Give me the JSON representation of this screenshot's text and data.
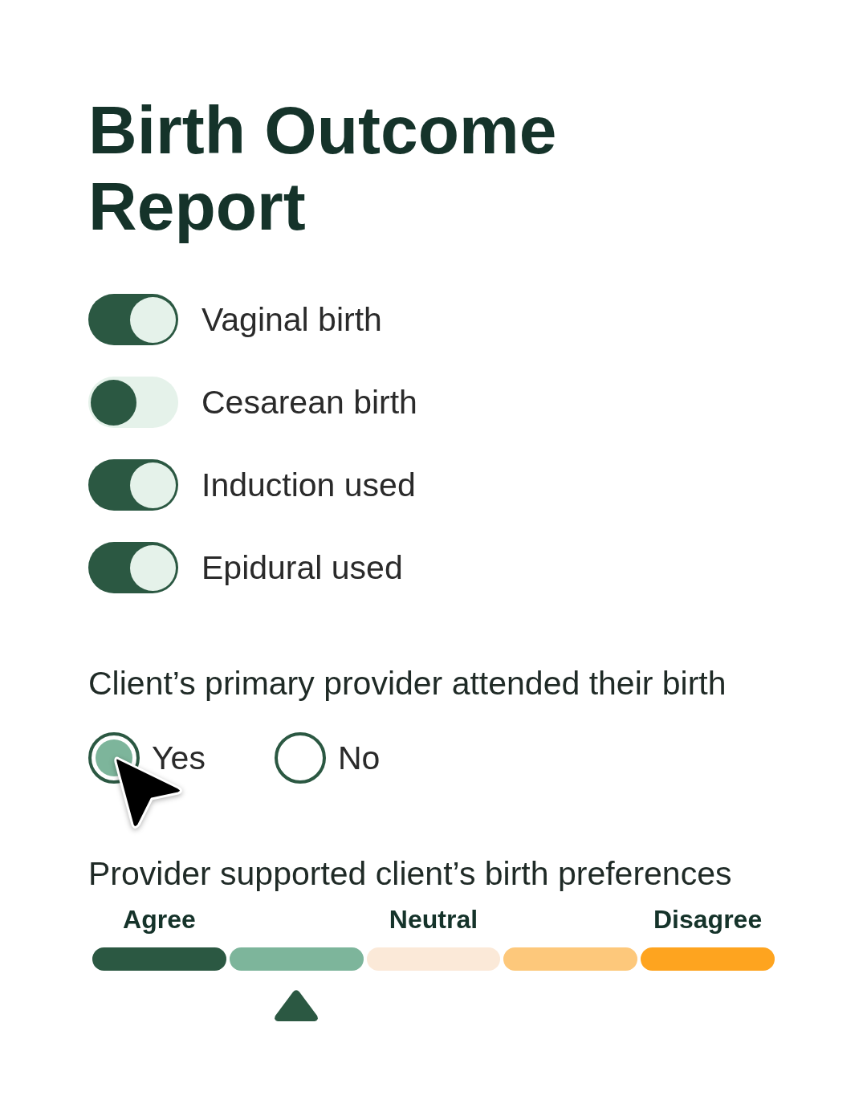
{
  "title": "Birth Outcome Report",
  "toggles": [
    {
      "label": "Vaginal birth",
      "on": true
    },
    {
      "label": "Cesarean birth",
      "on": false
    },
    {
      "label": "Induction used",
      "on": true
    },
    {
      "label": "Epidural used",
      "on": true
    }
  ],
  "question_1": {
    "prompt": "Client’s primary provider attended their birth",
    "options": [
      {
        "label": "Yes",
        "selected": true
      },
      {
        "label": "No",
        "selected": false
      }
    ]
  },
  "question_2": {
    "prompt": "Provider supported client’s birth preferences",
    "segments": [
      {
        "label": "Agree",
        "color": "#2b5842",
        "selected": false
      },
      {
        "color": "#7db59b",
        "selected": true
      },
      {
        "label": "Neutral",
        "color": "#fbe9d8",
        "selected": false
      },
      {
        "color": "#fdc87b",
        "selected": false
      },
      {
        "label": "Disagree",
        "color": "#fea41f",
        "selected": false
      }
    ]
  }
}
